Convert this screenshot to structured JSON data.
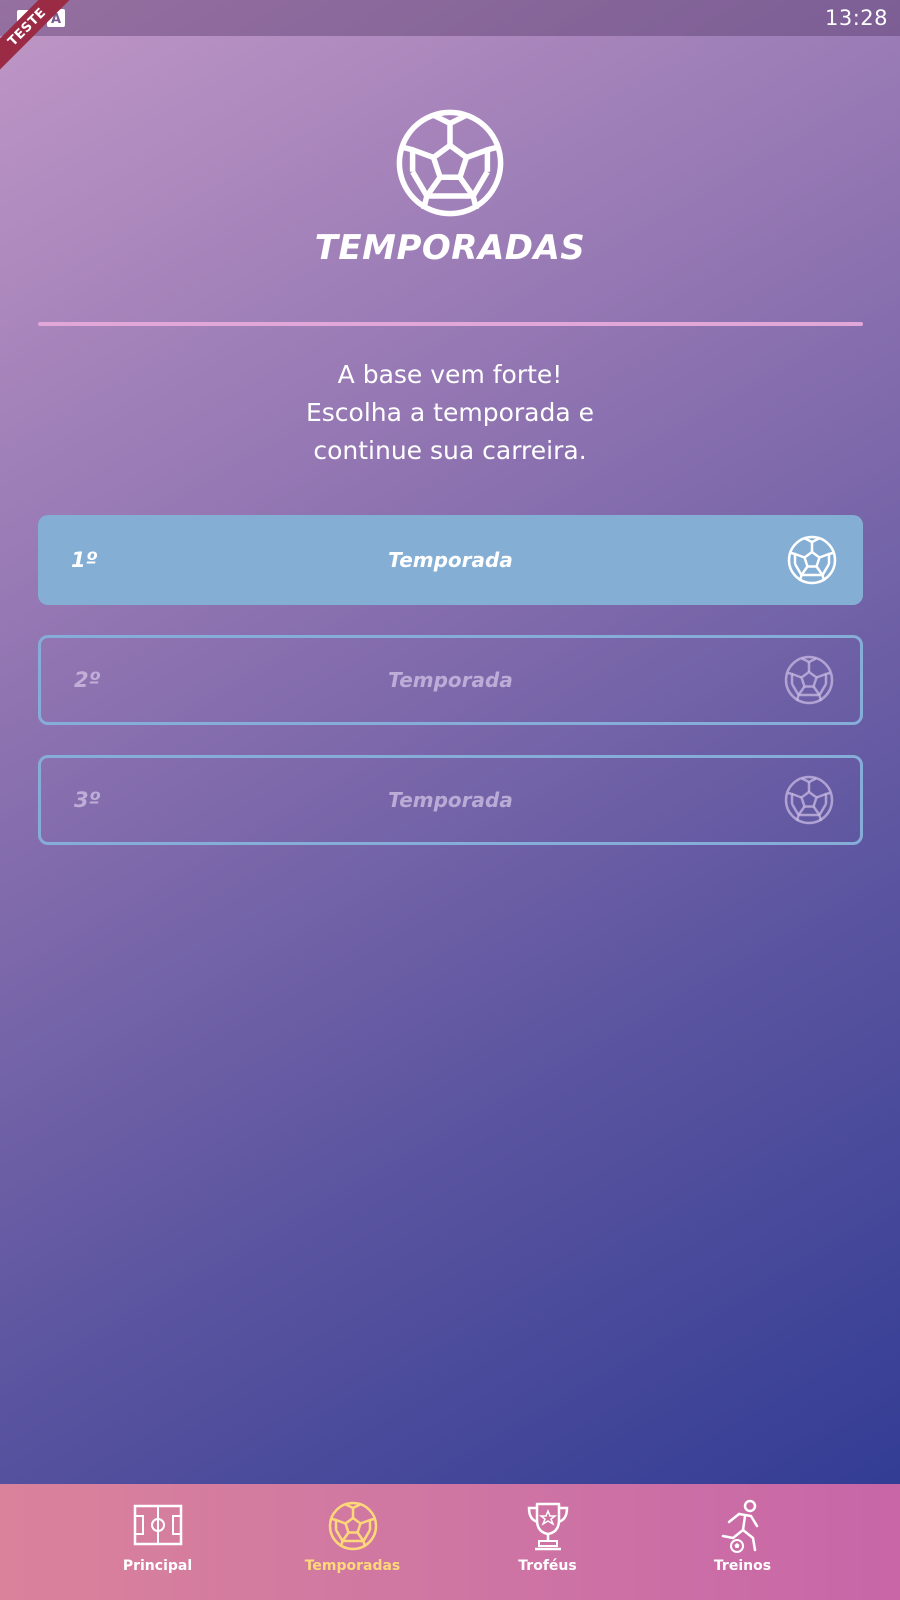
{
  "status_bar": {
    "time": "13:28",
    "icons": [
      "image-icon",
      "font-icon"
    ]
  },
  "debug_banner": "TESTE",
  "header": {
    "icon": "soccer-ball-icon",
    "title": "TEMPORADAS",
    "subtitle_lines": [
      "A base vem forte!",
      "Escolha a temporada e",
      "continue sua carreira."
    ]
  },
  "seasons": [
    {
      "number": "1º",
      "label": "Temporada",
      "state": "active"
    },
    {
      "number": "2º",
      "label": "Temporada",
      "state": "locked"
    },
    {
      "number": "3º",
      "label": "Temporada",
      "state": "locked"
    }
  ],
  "bottom_nav": {
    "items": [
      {
        "label": "Principal",
        "icon": "soccer-field-icon"
      },
      {
        "label": "Temporadas",
        "icon": "soccer-ball-icon",
        "selected": true
      },
      {
        "label": "Troféus",
        "icon": "trophy-icon"
      },
      {
        "label": "Treinos",
        "icon": "player-training-icon"
      }
    ]
  },
  "colors": {
    "active_season": "#84aed4",
    "locked_border": "#86acd8",
    "divider": "#e0a7d8",
    "nav_selected": "#ffd979"
  }
}
